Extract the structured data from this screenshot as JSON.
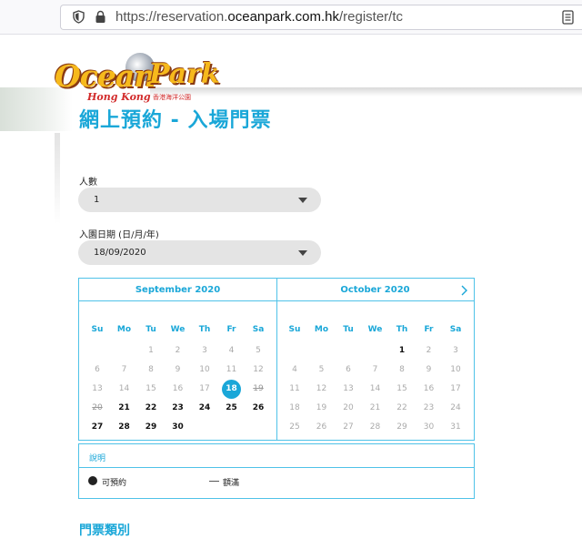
{
  "browser": {
    "url_prefix": "https://reservation.",
    "url_domain": "oceanpark.com.hk",
    "url_path": "/register/tc"
  },
  "logo": {
    "word1": "Ocean",
    "word2": "Park",
    "sub": "Hong Kong",
    "cn": "香港海洋公園"
  },
  "page_title": "網上預約 - 入場門票",
  "form": {
    "people_label": "人數",
    "people_value": "1",
    "date_label": "入園日期 (日/月/年)",
    "date_value": "18/09/2020"
  },
  "calendar": {
    "weekdays": [
      "Su",
      "Mo",
      "Tu",
      "We",
      "Th",
      "Fr",
      "Sa"
    ],
    "months": [
      {
        "title": "September 2020",
        "rows": [
          [
            "",
            "",
            "1",
            "2",
            "3",
            "4",
            "5"
          ],
          [
            "6",
            "7",
            "8",
            "9",
            "10",
            "11",
            "12"
          ],
          [
            "13",
            "14",
            "15",
            "16",
            "17",
            "18",
            "19"
          ],
          [
            "20",
            "21",
            "22",
            "23",
            "24",
            "25",
            "26"
          ],
          [
            "27",
            "28",
            "29",
            "30",
            "",
            "",
            ""
          ]
        ]
      },
      {
        "title": "October 2020",
        "rows": [
          [
            "",
            "",
            "",
            "",
            "1",
            "2",
            "3"
          ],
          [
            "4",
            "5",
            "6",
            "7",
            "8",
            "9",
            "10"
          ],
          [
            "11",
            "12",
            "13",
            "14",
            "15",
            "16",
            "17"
          ],
          [
            "18",
            "19",
            "20",
            "21",
            "22",
            "23",
            "24"
          ],
          [
            "25",
            "26",
            "27",
            "28",
            "29",
            "30",
            "31"
          ]
        ]
      }
    ],
    "selected": {
      "month": 0,
      "day": "18"
    },
    "available": {
      "0": [
        "21",
        "22",
        "23",
        "24",
        "25",
        "26",
        "27",
        "28",
        "29",
        "30"
      ],
      "1": [
        "1"
      ]
    },
    "struck": {
      "0": [
        "19",
        "20"
      ],
      "1": []
    }
  },
  "legend": {
    "title": "說明",
    "available_label": "可預約",
    "full_label": "額滿"
  },
  "ticket_heading": "門票類別",
  "colors": {
    "accent": "#1aa7d8",
    "border": "#4fc2e8"
  }
}
